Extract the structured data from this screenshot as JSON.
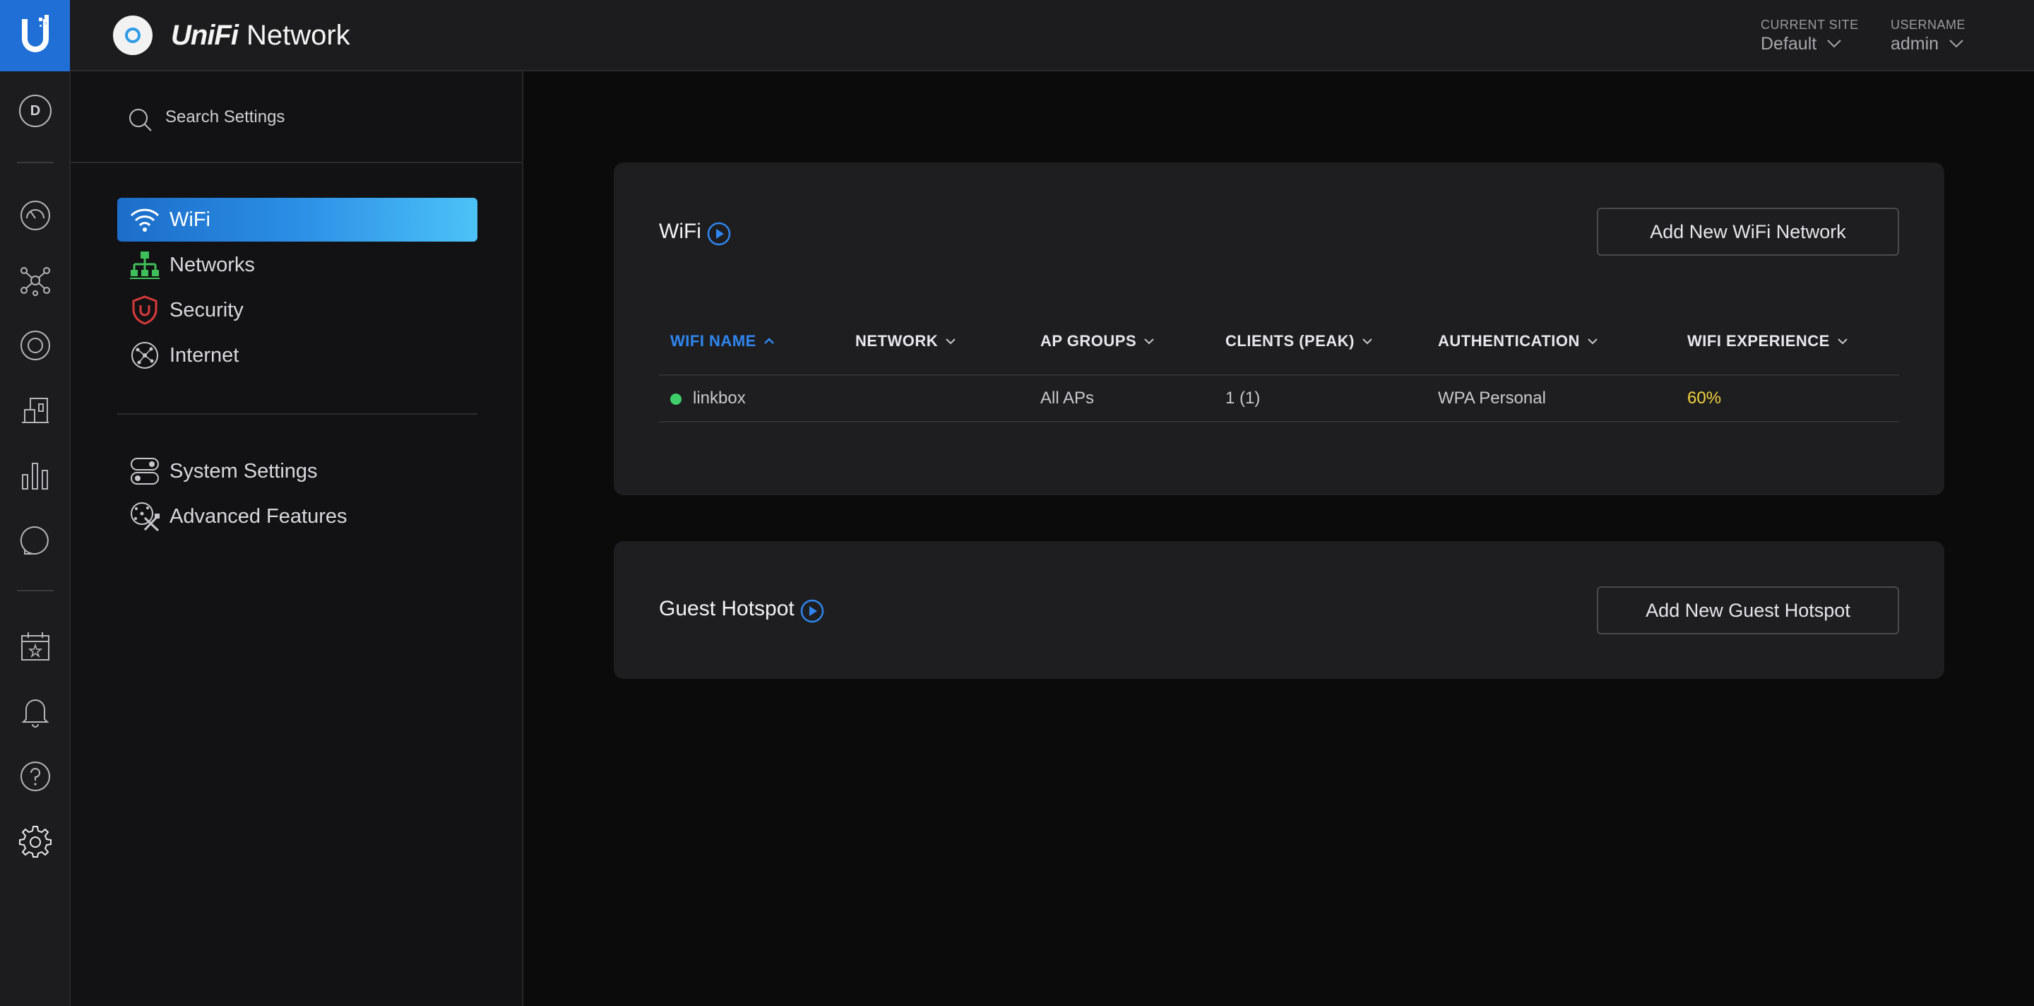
{
  "header": {
    "app_brand": "UniFi",
    "app_name": "Network",
    "current_site_label": "CURRENT SITE",
    "current_site_value": "Default",
    "username_label": "USERNAME",
    "username_value": "admin"
  },
  "rail": {
    "avatar_initial": "D",
    "icons": [
      "dashboard-icon",
      "topology-icon",
      "devices-icon",
      "clients-icon",
      "statistics-icon",
      "insights-icon",
      "events-icon",
      "alerts-icon",
      "help-icon",
      "settings-icon"
    ]
  },
  "sidebar": {
    "search_placeholder": "Search Settings",
    "items": [
      {
        "label": "WiFi",
        "icon": "wifi-icon",
        "active": true
      },
      {
        "label": "Networks",
        "icon": "networks-icon",
        "active": false
      },
      {
        "label": "Security",
        "icon": "shield-icon",
        "active": false
      },
      {
        "label": "Internet",
        "icon": "globe-icon",
        "active": false
      },
      {
        "label": "System Settings",
        "icon": "toggles-icon",
        "active": false
      },
      {
        "label": "Advanced Features",
        "icon": "tools-icon",
        "active": false
      }
    ]
  },
  "wifi_card": {
    "title": "WiFi",
    "add_button": "Add New WiFi Network",
    "columns": [
      "WIFI NAME",
      "NETWORK",
      "AP GROUPS",
      "CLIENTS (PEAK)",
      "AUTHENTICATION",
      "WIFI EXPERIENCE"
    ],
    "sorted_column": "WIFI NAME",
    "rows": [
      {
        "name": "linkbox",
        "network": "",
        "ap_groups": "All APs",
        "clients_peak": "1 (1)",
        "authentication": "WPA Personal",
        "wifi_experience": "60%",
        "status": "online"
      }
    ]
  },
  "hotspot_card": {
    "title": "Guest Hotspot",
    "add_button": "Add New Guest Hotspot"
  },
  "colors": {
    "accent": "#2f86f0",
    "status_online": "#3ecf6a",
    "experience_warning": "#f3d43c",
    "security_red": "#d83a3a",
    "networks_green": "#3fbf5a"
  }
}
